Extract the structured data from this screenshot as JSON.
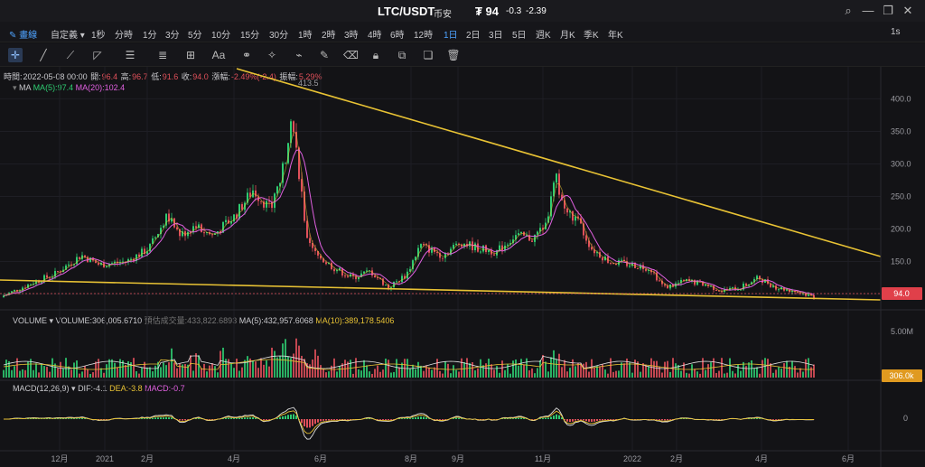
{
  "header": {
    "title": "LTC/USDT",
    "exchange": "币安",
    "price": "₮ 94",
    "change": "-0.3",
    "change_pct": "-2.39"
  },
  "timeframes": {
    "draw": "畫線",
    "custom": "自定義",
    "items": [
      "1秒",
      "分時",
      "1分",
      "3分",
      "5分",
      "10分",
      "15分",
      "30分",
      "1時",
      "2時",
      "3時",
      "4時",
      "6時",
      "12時",
      "1日",
      "2日",
      "3日",
      "5日",
      "週K",
      "月K",
      "季K",
      "年K"
    ],
    "active": "1日",
    "right": "1s"
  },
  "tools": [
    "crosshair-icon",
    "line-icon",
    "ray-icon",
    "triangle-icon",
    "parallel-lines-icon",
    "fib-icon",
    "measure-icon",
    "text-icon",
    "gann-icon",
    "pattern-icon",
    "brush-icon",
    "pen-icon",
    "erase-icon",
    "lock-icon",
    "copy-icon",
    "duplicate-icon",
    "trash-icon"
  ],
  "ohlc": {
    "time_label": "時間:",
    "time": "2022-05-08 00:00",
    "open_label": "開:",
    "open": "96.4",
    "high_label": "高:",
    "high": "96.7",
    "low_label": "低:",
    "low": "91.6",
    "close_label": "收:",
    "close": "94.0",
    "change_label": "漲幅:",
    "change": "-2.49%(-2.4)",
    "amp_label": "振幅:",
    "amp": "5.29%"
  },
  "ma": {
    "name": "MA",
    "ma5": "MA(5):97.4",
    "ma20": "MA(20):102.4"
  },
  "volume": {
    "name": "VOLUME",
    "vol": "VOLUME:306,005.6710",
    "forecast": "預估成交量:433,822.6893",
    "ma5": "MA(5):432,957.6068",
    "ma10": "MA(10):389,178.5406"
  },
  "macd": {
    "name": "MACD(12,26,9)",
    "dif": "DIF:-4.1",
    "dea": "DEA:-3.8",
    "macd": "MACD:-0.7"
  },
  "price_axis": [
    "400.0",
    "350.0",
    "300.0",
    "250.0",
    "200.0",
    "150.0",
    "100.0"
  ],
  "vol_axis": "5.00M",
  "macd_axis": "0",
  "peak_label": "413.5",
  "current_price_tag": "94.0",
  "current_vol_tag": "306.0k",
  "time_axis": [
    "12月",
    "2021",
    "2月",
    "4月",
    "6月",
    "8月",
    "9月",
    "11月",
    "2022",
    "2月",
    "4月",
    "6月"
  ],
  "colors": {
    "up": "#2ecc71",
    "down": "#e0505a",
    "trend": "#e8c234",
    "ma20": "#e060e0",
    "accent": "#4ea3ff"
  },
  "chart_data": {
    "type": "candlestick",
    "price_range": [
      80,
      420
    ],
    "series": [
      {
        "name": "MA(5)",
        "values": [
          97.4
        ]
      },
      {
        "name": "MA(20)",
        "values": [
          102.4
        ]
      }
    ]
  }
}
